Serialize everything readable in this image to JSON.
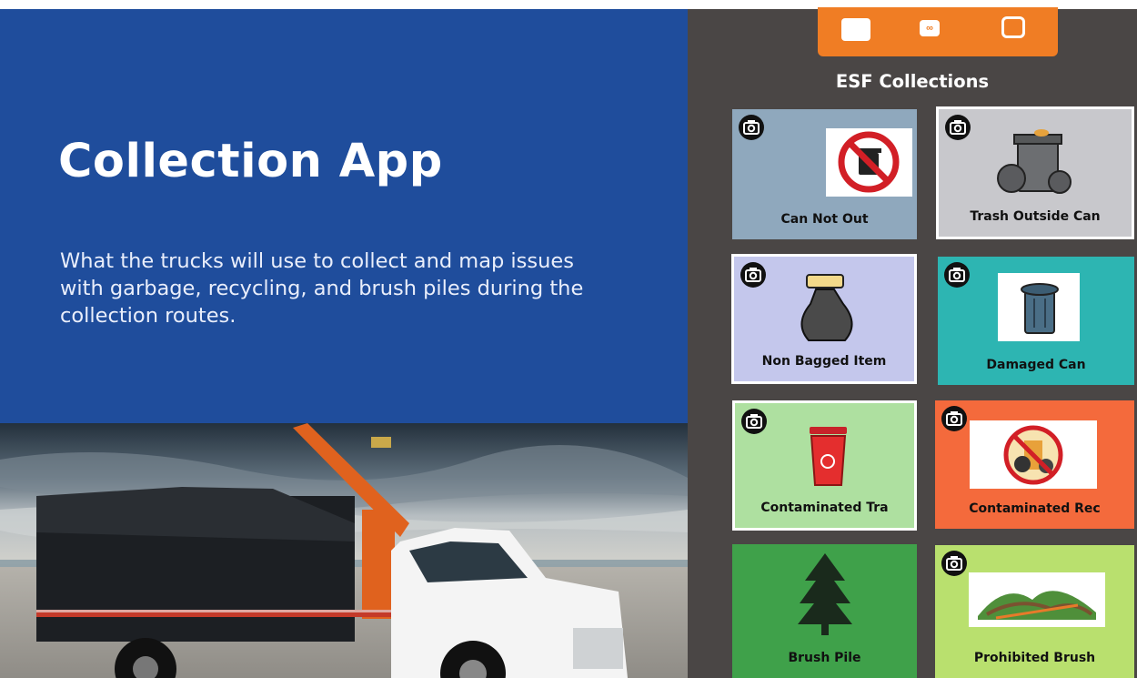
{
  "slide": {
    "title": "Collection App",
    "description": "What the trucks will use to collect and map issues with garbage, recycling, and brush piles during the collection routes."
  },
  "toolbar": {
    "buttons": [
      {
        "icon": "square-icon"
      },
      {
        "icon": "link-icon",
        "text": "∞"
      },
      {
        "icon": "frame-icon"
      }
    ],
    "color": "#f07d24"
  },
  "panel": {
    "title": "ESF Collections",
    "background": "#4a4645"
  },
  "tiles": [
    {
      "label": "Can Not Out",
      "color": "#8fa8bd",
      "icon": "no-trash-can-icon",
      "camera": true
    },
    {
      "label": "Trash Outside Can",
      "color": "#c8c8cc",
      "icon": "overflowing-trash-icon",
      "camera": true
    },
    {
      "label": "Non Bagged Item",
      "color": "#c4c7ec",
      "icon": "trash-bag-icon",
      "camera": true
    },
    {
      "label": "Damaged Can",
      "color": "#2db5b2",
      "icon": "damaged-can-icon",
      "camera": true
    },
    {
      "label": "Contaminated Tra",
      "color": "#aee0a0",
      "icon": "red-bin-icon",
      "camera": true
    },
    {
      "label": "Contaminated Rec",
      "color": "#f46a3c",
      "icon": "no-recycle-icon",
      "camera": true
    },
    {
      "label": "Brush Pile",
      "color": "#3fa14a",
      "icon": "tree-icon",
      "camera": false
    },
    {
      "label": "Prohibited Brush",
      "color": "#b9e06e",
      "icon": "brush-pile-icon",
      "camera": true
    }
  ]
}
